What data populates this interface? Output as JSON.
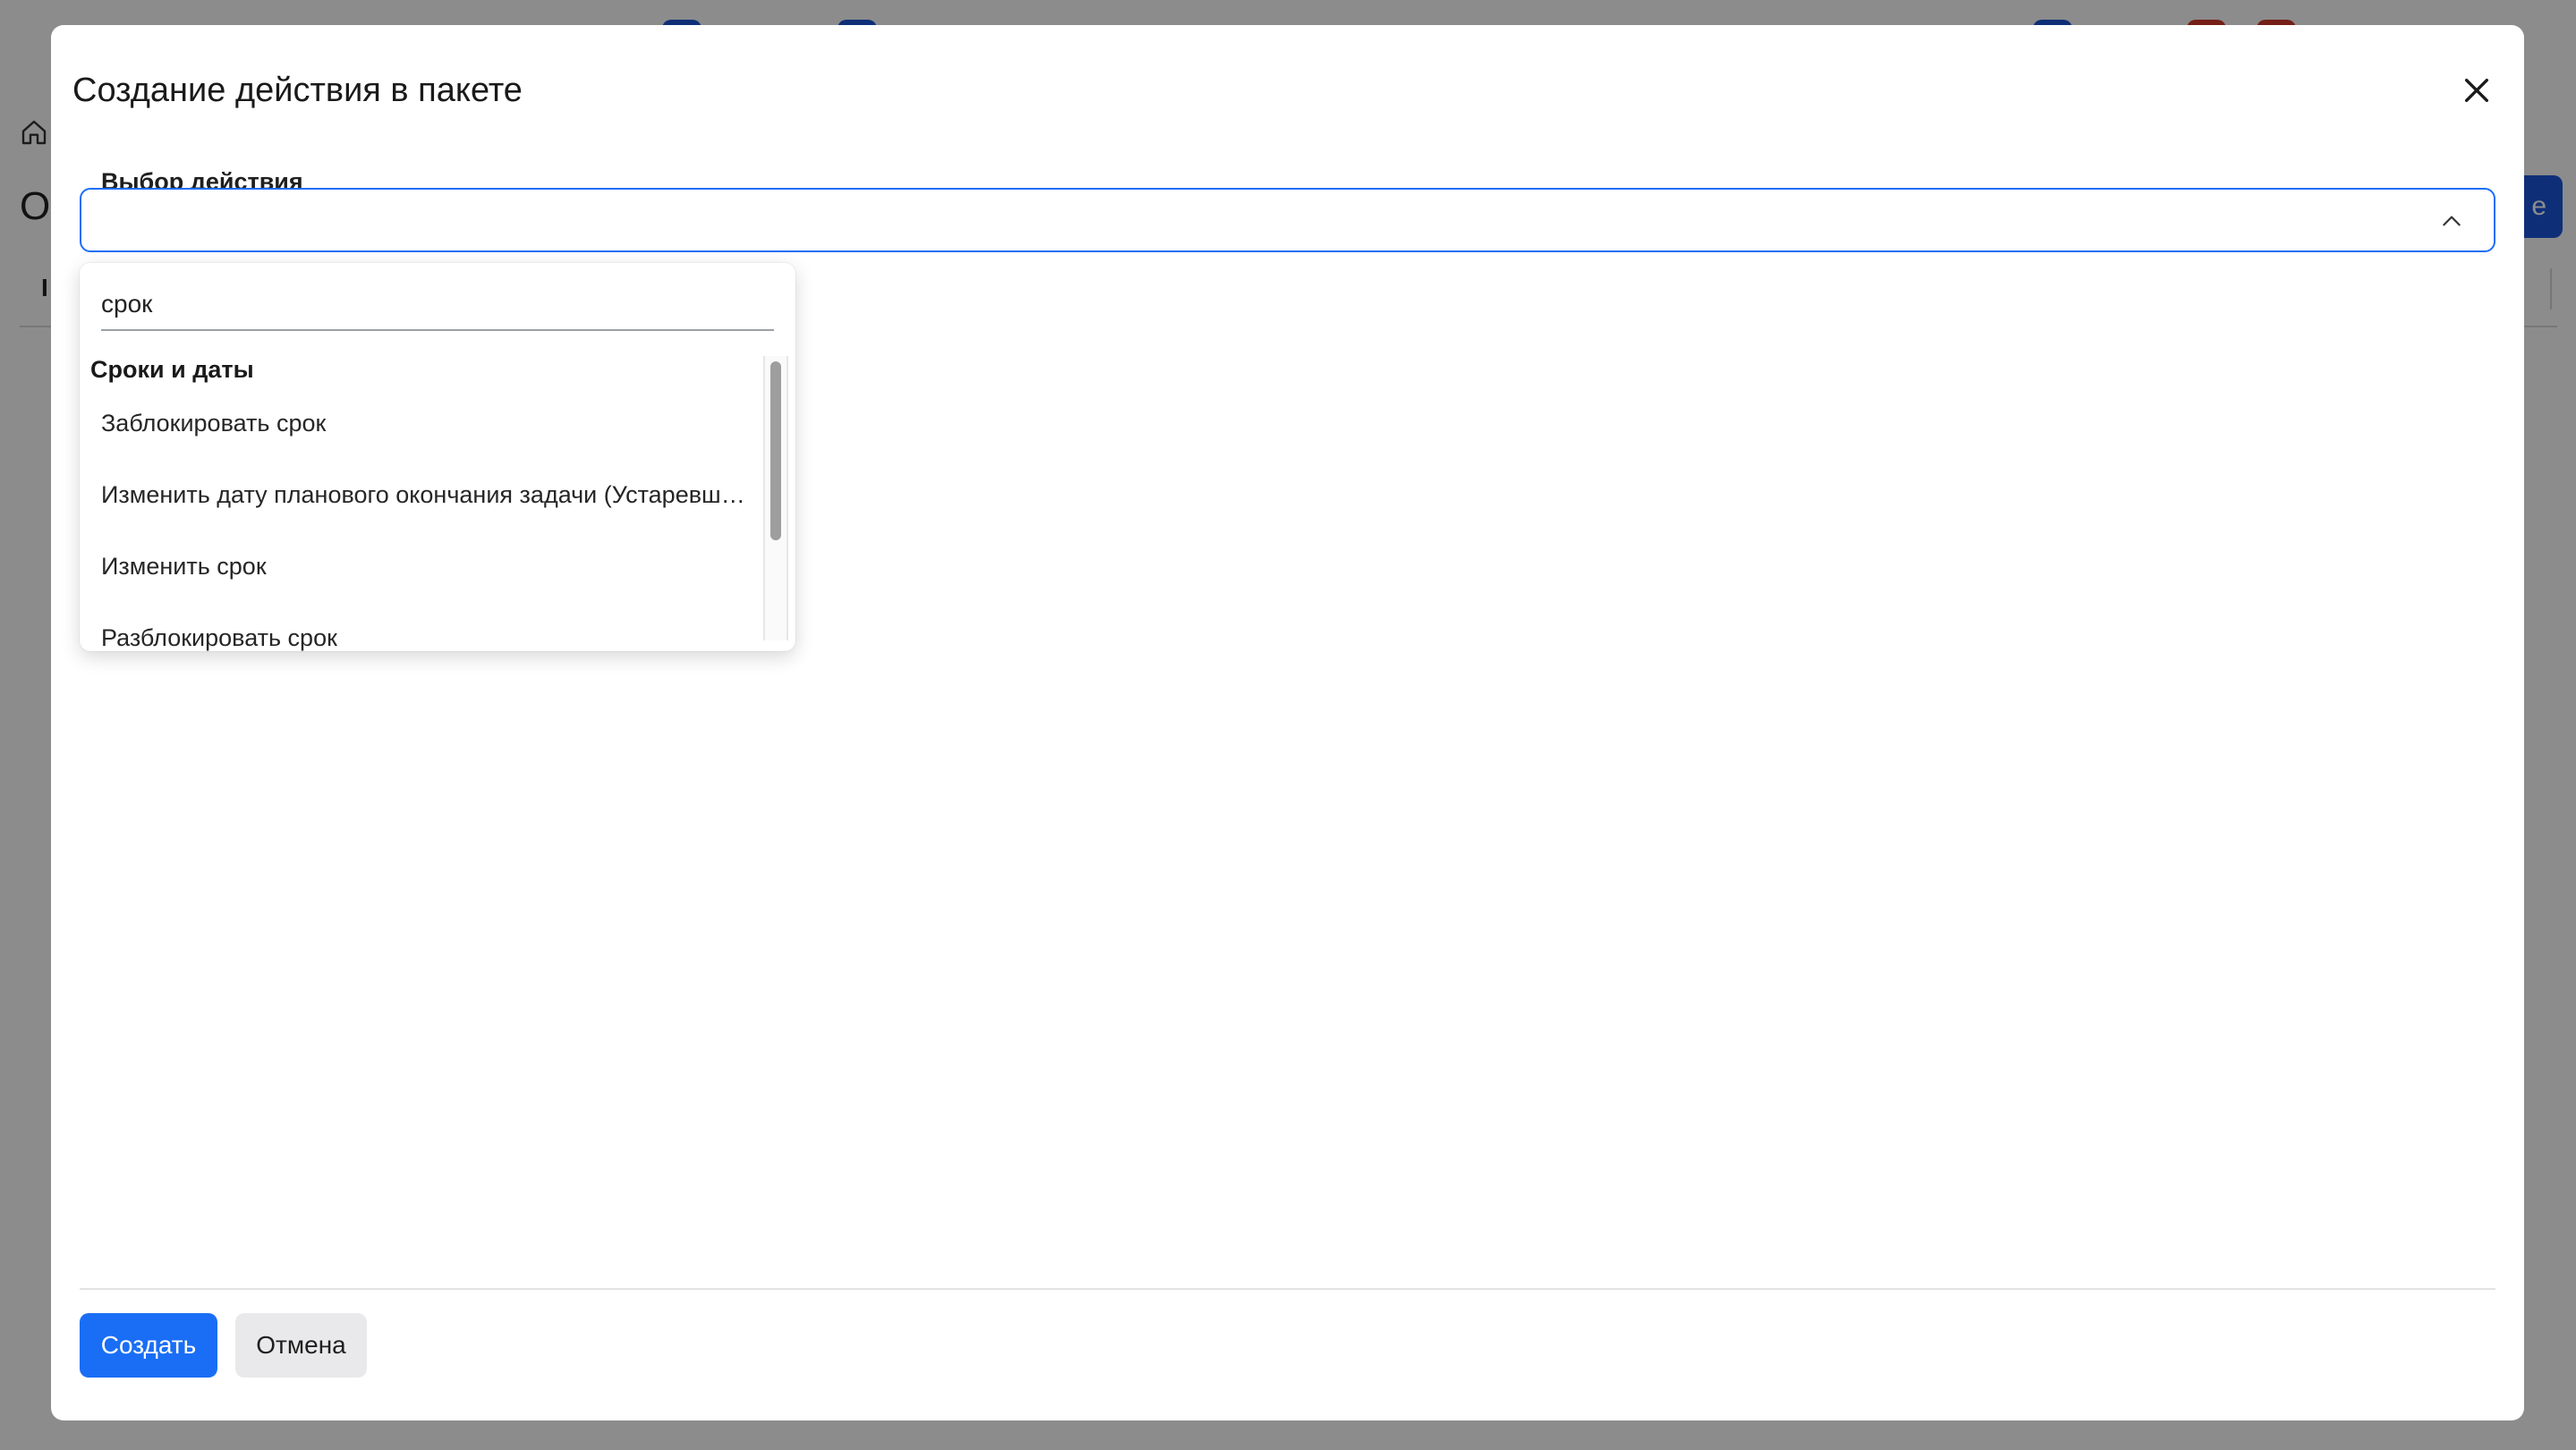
{
  "modal": {
    "title": "Создание действия в пакете",
    "close_icon": "close-icon"
  },
  "field": {
    "label": "Выбор действия",
    "value": "",
    "chevron_icon": "chevron-up-icon"
  },
  "dropdown": {
    "search_value": "срок",
    "group_label": "Сроки и даты",
    "items": [
      "Заблокировать срок",
      "Изменить дату планового окончания задачи (Устаревшее)",
      "Изменить срок",
      "Разблокировать срок"
    ]
  },
  "footer": {
    "create_label": "Создать",
    "cancel_label": "Отмена"
  },
  "background": {
    "page_title_fragment": "От",
    "table_header_fragment": "I",
    "primary_button_fragment": "е"
  },
  "colors": {
    "accent": "#1a6ef5",
    "secondary_button": "#e9e9eb",
    "overlay": "#8a8b8f"
  }
}
